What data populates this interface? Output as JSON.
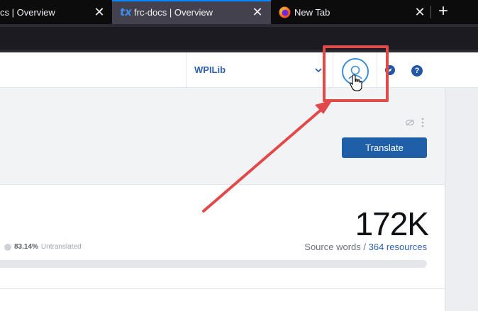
{
  "browser": {
    "tabs": [
      {
        "title": "cs | Overview",
        "close": "✕"
      },
      {
        "title": "frc-docs | Overview",
        "favicon": "tx",
        "close": "✕"
      },
      {
        "title": "New Tab",
        "favicon": "firefox-icon",
        "close": "✕"
      }
    ],
    "new_tab": "+"
  },
  "header": {
    "org": "WPILib",
    "help": "?"
  },
  "hero": {
    "translate_label": "Translate"
  },
  "stats": {
    "untranslated_pct": "83.14%",
    "untranslated_label": "Untranslated",
    "source_count": "172K",
    "source_words_label": "Source words /",
    "resources_link": "364 resources",
    "untranslated_fraction": 0.8314
  },
  "colors": {
    "accent": "#1f5fa8",
    "annotation": "#e24a4a",
    "link": "#2f62b4"
  }
}
